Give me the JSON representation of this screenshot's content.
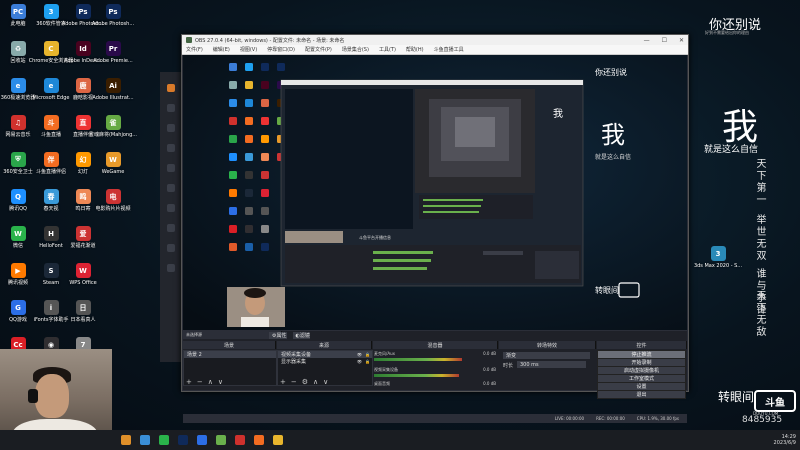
{
  "desktop": {
    "columns": [
      [
        {
          "label": "此电脑",
          "color": "#3b7dd8",
          "glyph": "PC"
        },
        {
          "label": "回收站",
          "color": "#8aa",
          "glyph": "♻"
        },
        {
          "label": "360极速浏览器",
          "color": "#2b8ce8",
          "glyph": "e"
        },
        {
          "label": "网易云音乐",
          "color": "#d0312d",
          "glyph": "♫"
        },
        {
          "label": "360安全卫士",
          "color": "#2aa54a",
          "glyph": "⛨"
        },
        {
          "label": "腾讯QQ",
          "color": "#1e90ff",
          "glyph": "Q"
        },
        {
          "label": "微信",
          "color": "#2ab34b",
          "glyph": "W"
        },
        {
          "label": "腾讯视频",
          "color": "#ff7a00",
          "glyph": "▶"
        },
        {
          "label": "QQ游戏",
          "color": "#2c6ee6",
          "glyph": "G"
        },
        {
          "label": "Adobe Creati...",
          "color": "#da1f26",
          "glyph": "Cc"
        },
        {
          "label": "360日历",
          "color": "#e05a2a",
          "glyph": "日"
        }
      ],
      [
        {
          "label": "360软件管家",
          "color": "#1ea0f0",
          "glyph": "3"
        },
        {
          "label": "Chrome安全浏览器",
          "color": "#e8b52d",
          "glyph": "C"
        },
        {
          "label": "Microsoft Edge",
          "color": "#1e88d8",
          "glyph": "e"
        },
        {
          "label": "斗鱼直播",
          "color": "#f36c21",
          "glyph": "斗"
        },
        {
          "label": "斗鱼直播伴侣",
          "color": "#f36c21",
          "glyph": "伴"
        },
        {
          "label": "春天视",
          "color": "#3a9ad9",
          "glyph": "春"
        },
        {
          "label": "HelloFont",
          "color": "#333",
          "glyph": "H"
        },
        {
          "label": "Steam",
          "color": "#1b2838",
          "glyph": "S"
        },
        {
          "label": "iFonts字体助手",
          "color": "#555",
          "glyph": "i"
        },
        {
          "label": "OBS Studio",
          "color": "#302e31",
          "glyph": "◉"
        },
        {
          "label": "CPHD高清风格大师",
          "color": "#1a5fa8",
          "glyph": "C"
        }
      ],
      [
        {
          "label": "Adobe Photosh...",
          "color": "#0f2a5a",
          "glyph": "Ps"
        },
        {
          "label": "Adobe InDesi...",
          "color": "#49021f",
          "glyph": "Id"
        },
        {
          "label": "鹿晗影视",
          "color": "#d64",
          "glyph": "鹿"
        },
        {
          "label": "直播伴侣",
          "color": "#e33",
          "glyph": "直"
        },
        {
          "label": "幻灯",
          "color": "#f90",
          "glyph": "幻"
        },
        {
          "label": "鸣日寄",
          "color": "#e85",
          "glyph": "鸣"
        },
        {
          "label": "爱福花渐道",
          "color": "#c33",
          "glyph": "爱"
        },
        {
          "label": "WPS Office",
          "color": "#d23",
          "glyph": "W"
        },
        {
          "label": "日本看真人",
          "color": "#555",
          "glyph": "日"
        },
        {
          "label": "7.18纪念日历",
          "color": "#888",
          "glyph": "7"
        },
        {
          "label": "logo样式2023",
          "color": "#0f2a5a",
          "glyph": "Ps"
        }
      ],
      [
        {
          "label": "Adobe Photosh...",
          "color": "#0f2a5a",
          "glyph": "Ps"
        },
        {
          "label": "Adobe Premie...",
          "color": "#2a0a4a",
          "glyph": "Pr"
        },
        {
          "label": "Adobe Illustrat...",
          "color": "#3a1e00",
          "glyph": "Ai"
        },
        {
          "label": "雀魂麻将(Mahjong...",
          "color": "#6a4",
          "glyph": "雀"
        },
        {
          "label": "WeGame",
          "color": "#e89a2a",
          "glyph": "W"
        },
        {
          "label": "电影购片片视频",
          "color": "#c33",
          "glyph": "电"
        }
      ]
    ],
    "right_icon": {
      "label": "3ds Max 2020 - S...",
      "color": "#2a8ab8",
      "glyph": "3"
    }
  },
  "wallpaper": {
    "line1": "你还别说",
    "line1_small": "好到不需要给出你的理由",
    "big_char": "我",
    "line2": "就是这么自信",
    "vert1": "天下第一",
    "vert2": "举世无双",
    "vert3": "谁与争锋",
    "vert4": "天下无敌"
  },
  "obs": {
    "title": "OBS 27.0.4 (64-bit, windows) - 配置文件: 未命名 - 场景: 未命名",
    "menu": [
      "文件(F)",
      "编辑(E)",
      "视图(V)",
      "停靠窗口(D)",
      "配置文件(P)",
      "场景集合(S)",
      "工具(T)",
      "帮助(H)",
      "斗鱼直播工具"
    ],
    "docks": {
      "scenes_header": "场景",
      "sources_header": "来源",
      "mixer_header": "混音器",
      "transitions_header": "转场特效",
      "controls_header": "控件",
      "scene_item": "场景 2",
      "source_items": [
        "视频采集设备",
        "显示器采集"
      ],
      "no_source_label": "未选择源",
      "props_btn": "属性",
      "filters_btn": "滤镜",
      "mixer_rows": [
        {
          "name": "麦克风/Aux",
          "vol": "0.0 dB"
        },
        {
          "name": "视频采集设备",
          "vol": "0.0 dB"
        },
        {
          "name": "桌面音频",
          "vol": "0.0 dB"
        }
      ],
      "transition_value": "渐变",
      "duration_label": "时长",
      "duration_value": "300 ms",
      "controls": [
        "停止推流",
        "开始录制",
        "启动虚拟摄像机",
        "工作室模式",
        "设置",
        "退出"
      ]
    },
    "status": {
      "live": "LIVE: 00:00:00",
      "rec": "REC: 00:00:00",
      "cpu": "CPU: 1.9%, 30.00 fps"
    },
    "nested_caption": "斗鱼平台开播信息"
  },
  "overlay": {
    "watermark": "转眼间",
    "logo": "斗鱼",
    "url": "DOUYU.COM",
    "room_id": "8485935"
  },
  "taskbar": {
    "icons": [
      "#e0902a",
      "#3a8fd8",
      "#2ab34b",
      "#0f2a5a",
      "#2c6ee6",
      "#6ab04c",
      "#d0312d",
      "#f36c21",
      "#e8b52d"
    ],
    "time": "14:29",
    "date": "2023/6/9"
  }
}
